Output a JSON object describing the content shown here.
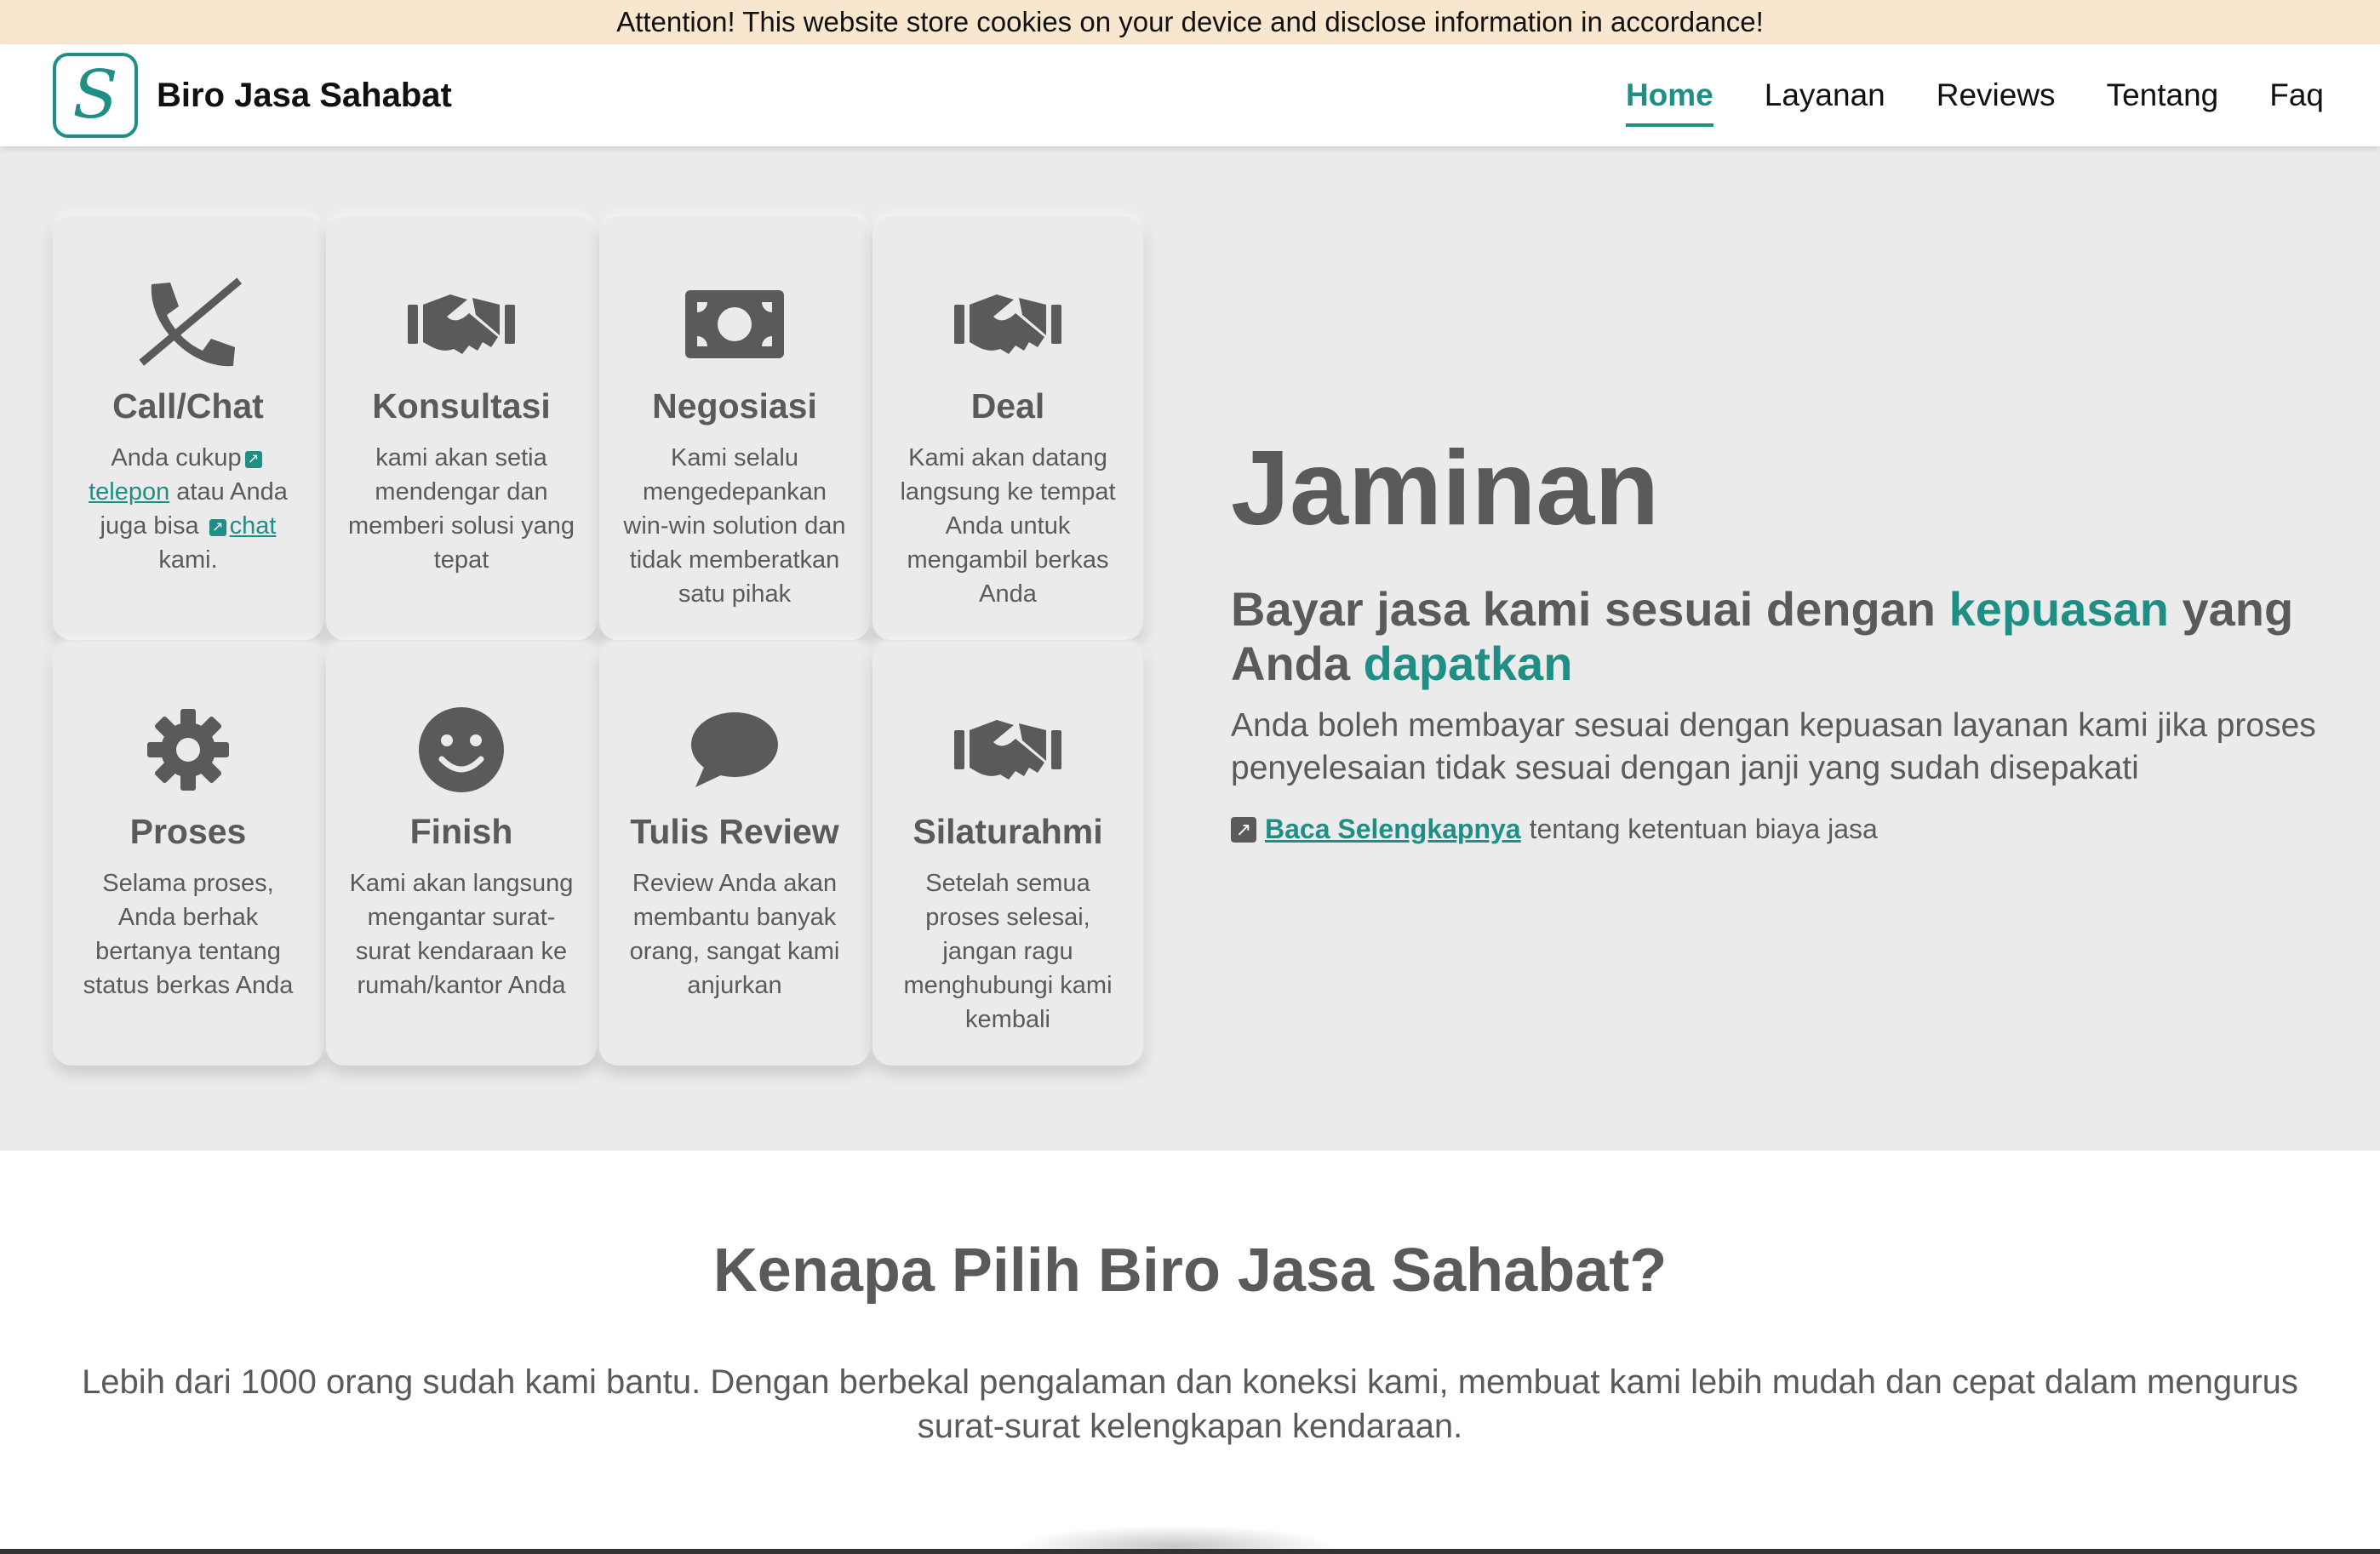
{
  "cookie_notice": "Attention! This website store cookies on your device and disclose information in accordance!",
  "brand": {
    "logo_letter": "S",
    "name": "Biro Jasa Sahabat"
  },
  "nav": {
    "items": [
      {
        "label": "Home",
        "active": true
      },
      {
        "label": "Layanan"
      },
      {
        "label": "Reviews"
      },
      {
        "label": "Tentang"
      },
      {
        "label": "Faq"
      }
    ]
  },
  "steps": [
    {
      "icon": "phone-slash-icon",
      "title": "Call/Chat",
      "desc_parts": [
        "Anda cukup",
        "telepon",
        "atau Anda juga bisa",
        "chat",
        "kami."
      ]
    },
    {
      "icon": "handshake-icon",
      "title": "Konsultasi",
      "desc": "kami akan setia mendengar dan memberi solusi yang tepat"
    },
    {
      "icon": "money-bill-icon",
      "title": "Negosiasi",
      "desc": "Kami selalu mengedepankan win-win solution dan tidak memberatkan satu pihak"
    },
    {
      "icon": "handshake-icon",
      "title": "Deal",
      "desc": "Kami akan datang langsung ke tempat Anda untuk mengambil berkas Anda"
    },
    {
      "icon": "gear-icon",
      "title": "Proses",
      "desc": "Selama proses, Anda berhak bertanya tentang status berkas Anda"
    },
    {
      "icon": "smile-icon",
      "title": "Finish",
      "desc": "Kami akan langsung mengantar surat-surat kendaraan ke rumah/kantor Anda"
    },
    {
      "icon": "comment-icon",
      "title": "Tulis Review",
      "desc": "Review Anda akan membantu banyak orang, sangat kami anjurkan"
    },
    {
      "icon": "handshake-icon",
      "title": "Silaturahmi",
      "desc": "Setelah semua proses selesai, jangan ragu menghubungi kami kembali"
    }
  ],
  "jaminan": {
    "title": "Jaminan",
    "sub_1": "Bayar jasa kami sesuai dengan ",
    "sub_hl_1": "kepuasan",
    "sub_2": " yang Anda ",
    "sub_hl_2": "dapatkan",
    "desc": "Anda boleh membayar sesuai dengan kepuasan layanan kami jika proses penyelesaian tidak sesuai dengan janji yang sudah disepakati",
    "more_link": "Baca Selengkapnya",
    "more_text": "tentang ketentuan biaya jasa"
  },
  "why": {
    "title": "Kenapa Pilih Biro Jasa Sahabat?",
    "desc": "Lebih dari 1000 orang sudah kami bantu. Dengan berbekal pengalaman dan koneksi kami, membuat kami lebih mudah dan cepat dalam mengurus surat-surat kelengkapan kendaraan."
  },
  "colors": {
    "accent": "#1f8f86",
    "hero_bg": "#ebebeb",
    "cookie_bg": "#f8e6cf",
    "text": "#5a5a5a"
  }
}
